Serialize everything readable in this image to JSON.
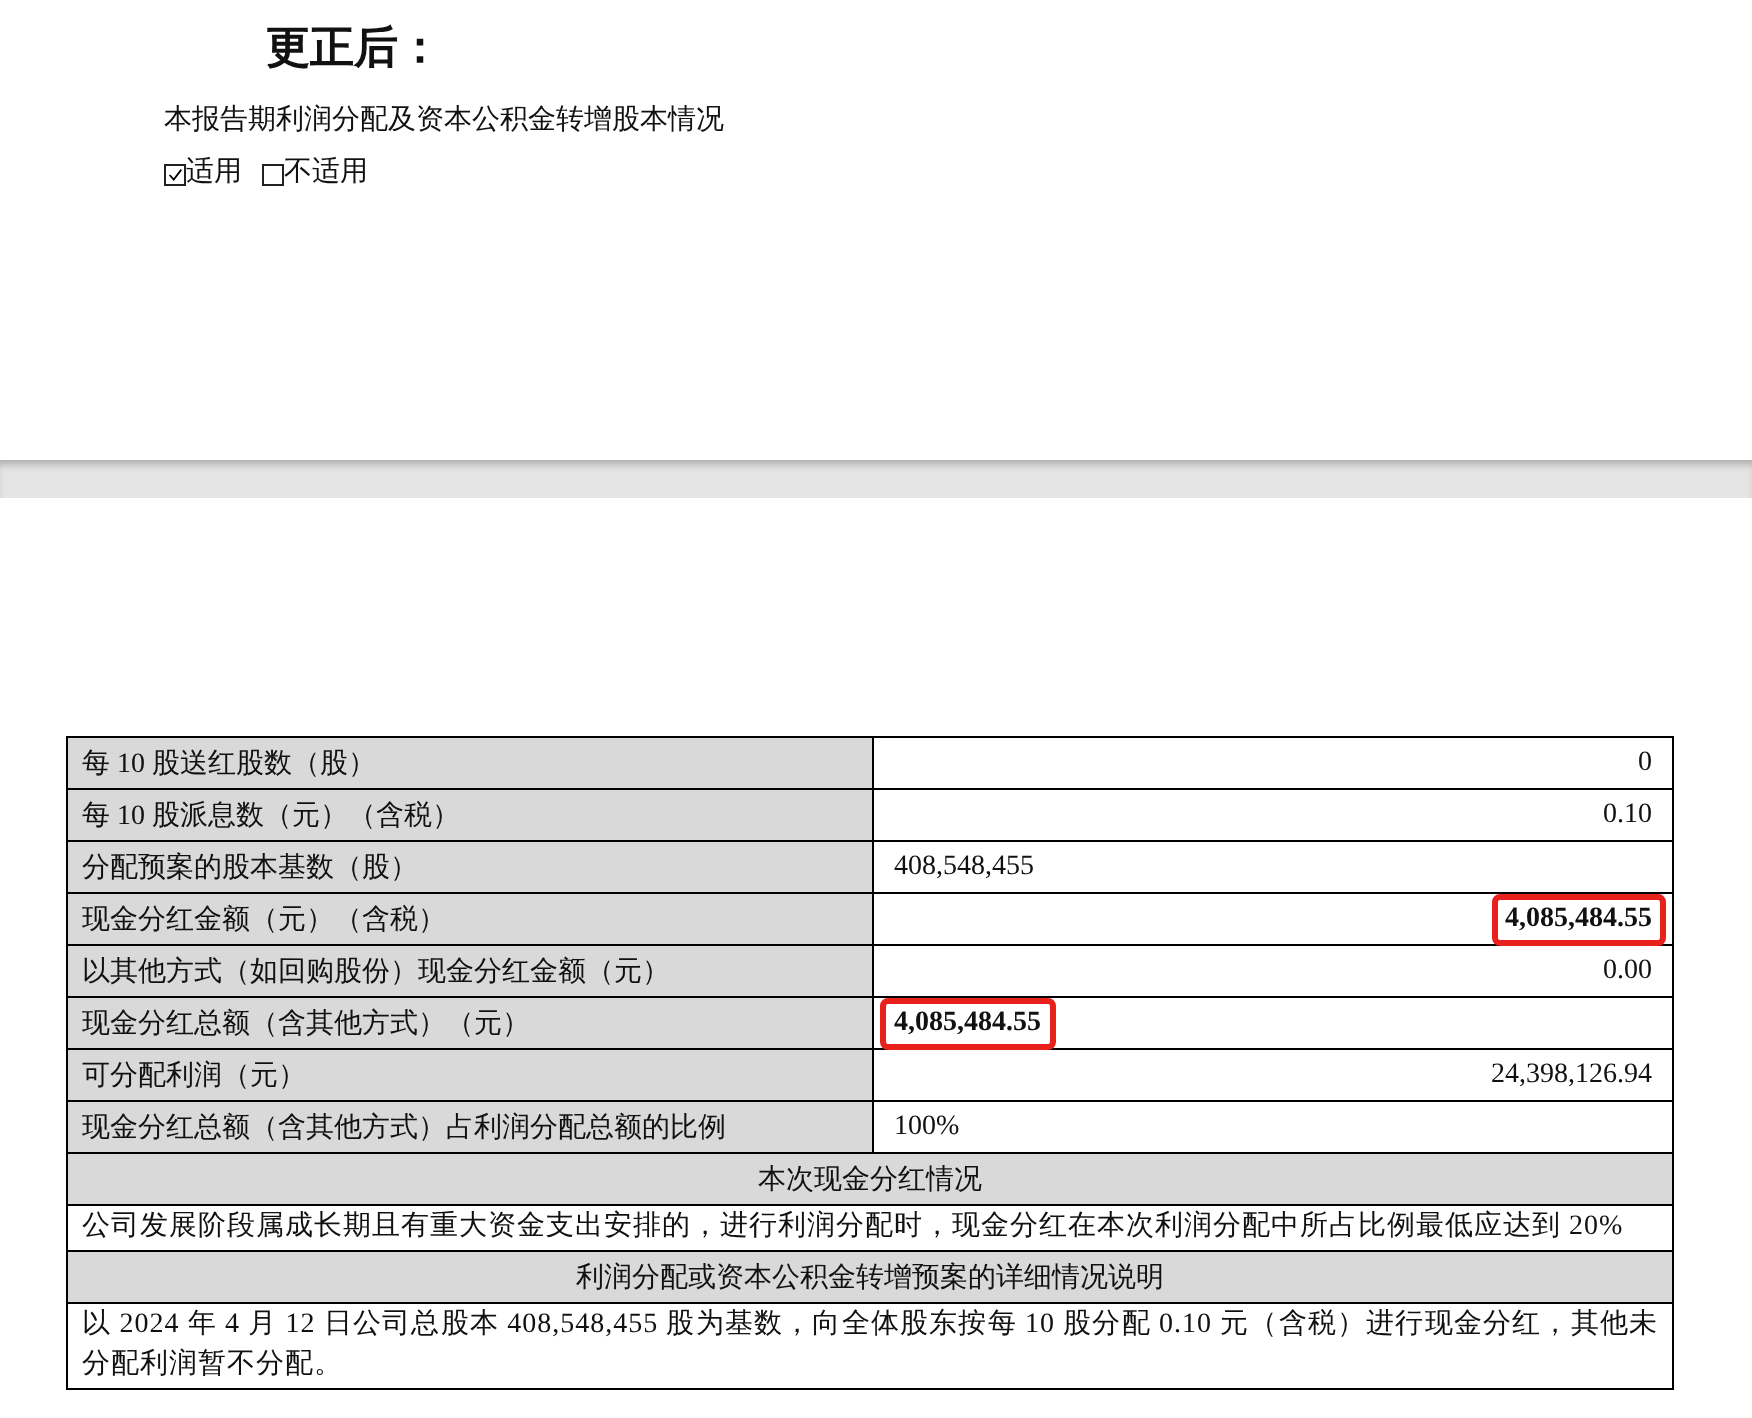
{
  "pages": [
    {
      "title": "更正后：",
      "subtitle": "本报告期利润分配及资本公积金转增股本情况",
      "options": [
        {
          "label": "适用",
          "checked": true
        },
        {
          "label": "不适用",
          "checked": false
        }
      ]
    },
    {
      "table": {
        "rows": [
          {
            "label": "每 10 股送红股数（股）",
            "value": "0",
            "kind": "right",
            "highlighted": false
          },
          {
            "label": "每 10 股派息数（元）（含税）",
            "value": "0.10",
            "kind": "right",
            "highlighted": false
          },
          {
            "label": "分配预案的股本基数（股）",
            "value": "408,548,455",
            "kind": "left",
            "highlighted": false
          },
          {
            "label": "现金分红金额（元）（含税）",
            "value": "4,085,484.55",
            "kind": "right",
            "highlighted": true
          },
          {
            "label": "以其他方式（如回购股份）现金分红金额（元）",
            "value": "0.00",
            "kind": "right",
            "highlighted": false
          },
          {
            "label": "现金分红总额（含其他方式）（元）",
            "value": "4,085,484.55",
            "kind": "left",
            "highlighted": true
          },
          {
            "label": "可分配利润（元）",
            "value": "24,398,126.94",
            "kind": "right",
            "highlighted": false
          },
          {
            "label": "现金分红总额（含其他方式）占利润分配总额的比例",
            "value": "100%",
            "kind": "left",
            "highlighted": false
          }
        ],
        "sections": [
          {
            "heading": "本次现金分红情况",
            "text": "公司发展阶段属成长期且有重大资金支出安排的，进行利润分配时，现金分红在本次利润分配中所占比例最低应达到 20%"
          },
          {
            "heading": "利润分配或资本公积金转增预案的详细情况说明",
            "text": "以 2024 年 4 月 12 日公司总股本 408,548,455 股为基数，向全体股东按每 10 股分配 0.10 元（含税）进行现金分红，其他未分配利润暂不分配。"
          }
        ]
      }
    }
  ]
}
